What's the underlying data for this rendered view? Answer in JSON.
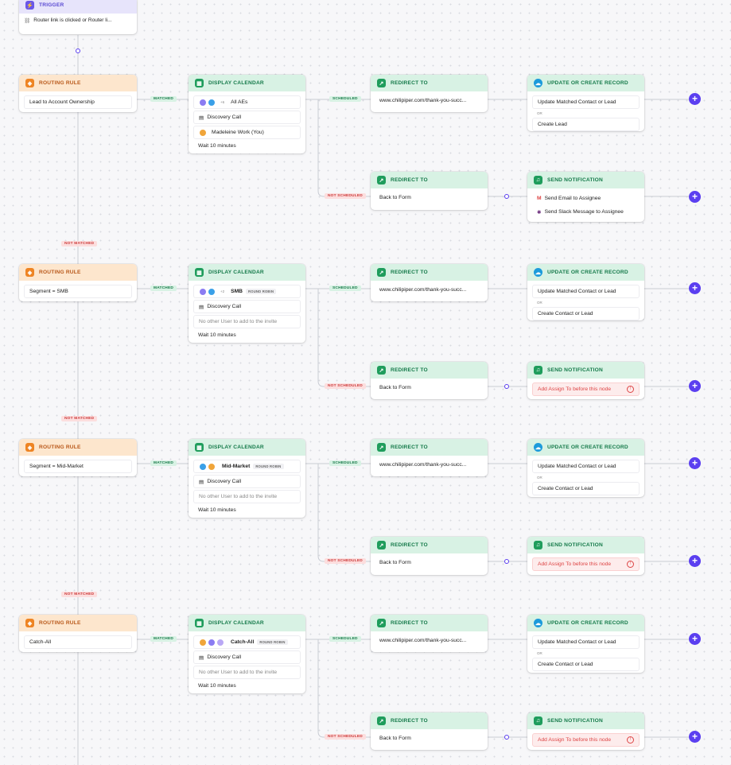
{
  "trigger": {
    "title": "TRIGGER",
    "text": "Router link is clicked or Router li..."
  },
  "labels": {
    "matched": "MATCHED",
    "not_matched": "NOT MATCHED",
    "scheduled": "SCHEDULED",
    "not_scheduled": "NOT SCHEDULED",
    "or": "OR",
    "round_robin": "ROUND ROBIN"
  },
  "headers": {
    "routing_rule": "ROUTING RULE",
    "display_calendar": "DISPLAY CALENDAR",
    "redirect_to": "REDIRECT TO",
    "update_record": "UPDATE OR CREATE RECORD",
    "send_notification": "SEND NOTIFICATION"
  },
  "rows": [
    {
      "rule": "Lead to Account Ownership",
      "team": "All AEs",
      "team_extra": "+6",
      "meeting": "Discovery Call",
      "invitee": "Madeleine Work (You)",
      "wait": "Wait 10 minutes",
      "url": "www.chilipiper.com/thank-you-succ...",
      "record_a": "Update Matched Contact or Lead",
      "record_b": "Create Lead",
      "fallback": "Back to Form",
      "notify_a": "Send Email to Assignee",
      "notify_b": "Send Slack Message to Assignee"
    },
    {
      "rule": "Segment = SMB",
      "team": "SMB",
      "team_extra": "+2",
      "meeting": "Discovery Call",
      "invitee": "No other User to add to the invite",
      "wait": "Wait 10 minutes",
      "url": "www.chilipiper.com/thank-you-succ...",
      "record_a": "Update Matched Contact or Lead",
      "record_b": "Create Contact or Lead",
      "fallback": "Back to Form",
      "warning": "Add Assign To before this node"
    },
    {
      "rule": "Segment = Mid-Market",
      "team": "Mid-Market",
      "meeting": "Discovery Call",
      "invitee": "No other User to add to the invite",
      "wait": "Wait 10 minutes",
      "url": "www.chilipiper.com/thank-you-succ...",
      "record_a": "Update Matched Contact or Lead",
      "record_b": "Create Contact or Lead",
      "fallback": "Back to Form",
      "warning": "Add Assign To before this node"
    },
    {
      "rule": "Catch-All",
      "team": "Catch-All",
      "meeting": "Discovery Call",
      "invitee": "No other User to add to the invite",
      "wait": "Wait 10 minutes",
      "url": "www.chilipiper.com/thank-you-succ...",
      "record_a": "Update Matched Contact or Lead",
      "record_b": "Create Contact or Lead",
      "fallback": "Back to Form",
      "warning": "Add Assign To before this node"
    }
  ],
  "colors": {
    "accent": "#5b3ff0",
    "green": "#1f9d5c",
    "orange": "#ee8423",
    "red": "#d44444"
  },
  "icons": {
    "trigger": "link-icon",
    "rule": "routing-rule-icon",
    "calendar": "calendar-icon",
    "redirect": "redirect-icon",
    "record": "salesforce-cloud-icon",
    "notify": "bell-icon",
    "plus": "add-step-icon",
    "gmail": "gmail-icon",
    "slack": "slack-icon",
    "warning": "warning-icon"
  }
}
